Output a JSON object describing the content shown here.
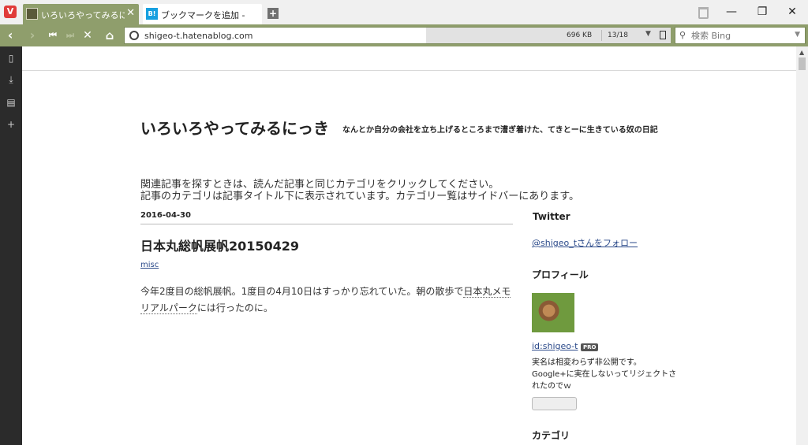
{
  "browser": {
    "tabs": [
      {
        "title": "いろいろやってみるにっき",
        "close": "✕",
        "active": true
      },
      {
        "title": "ブックマークを追加 - はてなブックマーク",
        "favicon_label": "B!",
        "active": false
      }
    ],
    "new_tab": "+",
    "window_controls": {
      "minimize": "—",
      "maximize": "❐",
      "close": "✕"
    },
    "address": {
      "url": "shigeo-t.hatenablog.com",
      "size": "696 KB",
      "count": "13/18"
    },
    "search": {
      "placeholder": "検索 Bing"
    }
  },
  "page": {
    "blog_title": "いろいろやってみるにっき",
    "blog_description": "なんとか自分の会社を立ち上げるところまで漕ぎ着けた、てきとーに生きている奴の日記",
    "notice_line1": "関連記事を探すときは、読んだ記事と同じカテゴリをクリックしてください。",
    "notice_line2": "記事のカテゴリは記事タイトル下に表示されています。カテゴリー覧はサイドバーにあります。",
    "post": {
      "date": "2016-04-30",
      "title": "日本丸総帆展帆20150429",
      "category": "misc",
      "body_part1": "今年2度目の総帆展帆。1度目の4月10日はすっかり忘れていた。朝の散歩で",
      "body_link": "日本丸メモリアルパーク",
      "body_part2": "には行ったのに。"
    },
    "sidebar": {
      "twitter_heading": "Twitter",
      "twitter_follow": "@shigeo_tさんをフォロー",
      "profile_heading": "プロフィール",
      "profile_id": "id:shigeo-t",
      "pro_badge": "PRO",
      "profile_line1": "実名は相変わらず非公開です。",
      "profile_line2": "Google+に実在しないってリジェクトさ",
      "profile_line3": "れたのでｗ",
      "category_heading": "カテゴリ"
    }
  },
  "colors": {
    "accent": "#8f9e6c",
    "link": "#2b4a8a",
    "side_panel": "#2b2b2b"
  }
}
